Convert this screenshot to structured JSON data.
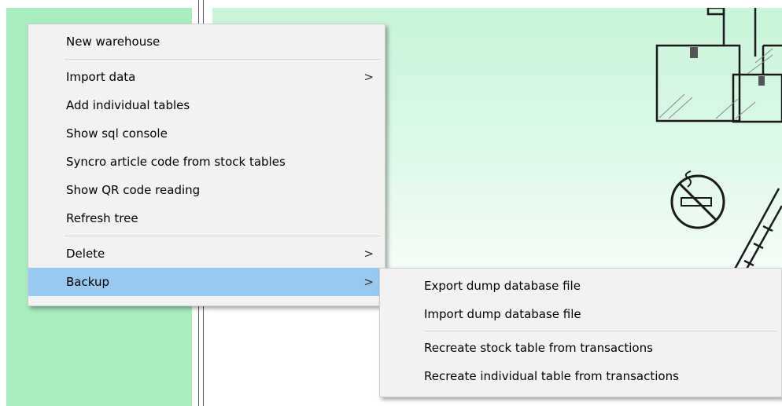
{
  "context_menu": {
    "items": [
      {
        "label": "New warehouse"
      },
      {
        "label": "Import data",
        "submenu_arrow": ">"
      },
      {
        "label": "Add individual tables"
      },
      {
        "label": "Show sql console"
      },
      {
        "label": "Syncro article code from stock tables"
      },
      {
        "label": "Show QR code reading"
      },
      {
        "label": "Refresh tree"
      },
      {
        "label": "Delete",
        "submenu_arrow": ">"
      },
      {
        "label": "Backup",
        "submenu_arrow": ">",
        "highlighted": true
      }
    ]
  },
  "backup_submenu": {
    "items": [
      {
        "label": "Export dump database file"
      },
      {
        "label": "Import dump database file"
      },
      {
        "label": "Recreate stock table from transactions"
      },
      {
        "label": "Recreate individual table from transactions"
      }
    ]
  },
  "colors": {
    "tree_panel_bg": "#a8ecc0",
    "menu_bg": "#f2f2f2",
    "menu_highlight": "#99c9ef",
    "content_gradient_top": "#c9f5da"
  },
  "icons": [
    "warehouse-boxes-illustration",
    "no-smoking-sign-icon",
    "ladder-illustration"
  ]
}
